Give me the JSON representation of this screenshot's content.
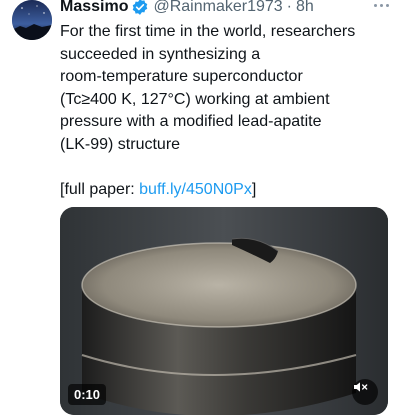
{
  "author": {
    "name": "Massimo",
    "handle": "@Rainmaker1973",
    "separator": "·",
    "time": "8h",
    "verified": true,
    "avatar_icon": "night-sky-avatar"
  },
  "tweet": {
    "body": "For the first time in the world, researchers\nsucceeded in synthesizing a\nroom-temperature superconductor\n(Tc≥400 K, 127°C) working at ambient\npressure with a modified lead-apatite\n(LK-99) structure",
    "paper_prefix": "[full paper: ",
    "paper_link": "buff.ly/450N0Px",
    "paper_suffix": "]"
  },
  "media": {
    "video_time": "0:10",
    "mute_icon": "speaker-muted-icon"
  },
  "colors": {
    "link": "#1d9bf0",
    "verified": "#1d9bf0",
    "secondary_text": "#536471"
  }
}
